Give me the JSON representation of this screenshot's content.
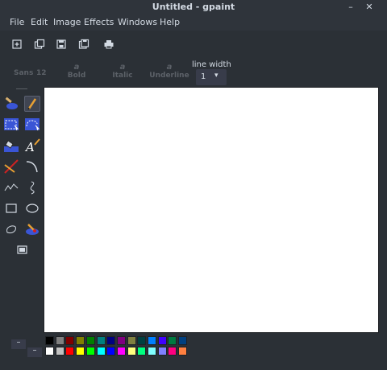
{
  "window": {
    "title": "Untitled - gpaint",
    "minimize_glyph": "–",
    "close_glyph": "✕"
  },
  "menu": [
    "File",
    "Edit",
    "Image",
    "Effects",
    "Windows",
    "Help"
  ],
  "toolbar": {
    "buttons": [
      "new-icon",
      "open-icon",
      "save-icon",
      "save-as-icon",
      "print-icon"
    ]
  },
  "fontbar": {
    "font_name": "Sans",
    "font_size": "12",
    "bold": {
      "glyph": "a",
      "label": "Bold"
    },
    "italic": {
      "glyph": "a",
      "label": "Italic"
    },
    "underline": {
      "glyph": "a",
      "label": "Underline"
    },
    "line_width_label": "line width",
    "line_width_value": "1",
    "dropdown_glyph": "▾"
  },
  "tools": [
    "eraser-tool",
    "pencil-tool",
    "rectangle-select-tool",
    "lasso-select-tool",
    "paint-bucket-tool",
    "text-tool",
    "line-tool",
    "curve-tool",
    "multiline-tool",
    "freehand-tool",
    "rectangle-tool",
    "oval-tool",
    "closed-freehand-tool",
    "paintbrush-tool",
    "fill-mode-toggle"
  ],
  "active_tool": "pencil-tool",
  "palette": {
    "fg_glyph": "–",
    "bg_glyph": "–",
    "row1": [
      "#000000",
      "#808080",
      "#800000",
      "#808000",
      "#008000",
      "#008080",
      "#000080",
      "#800080",
      "#808040",
      "#004040",
      "#0080ff",
      "#4000ff",
      "#007a40",
      "#004080"
    ],
    "row2": [
      "#ffffff",
      "#c0c0c0",
      "#ff0000",
      "#ffff00",
      "#00ff00",
      "#00ffff",
      "#0000ff",
      "#ff00ff",
      "#ffff80",
      "#00ff80",
      "#80ffff",
      "#8080ff",
      "#ff0080",
      "#ff8040"
    ]
  }
}
